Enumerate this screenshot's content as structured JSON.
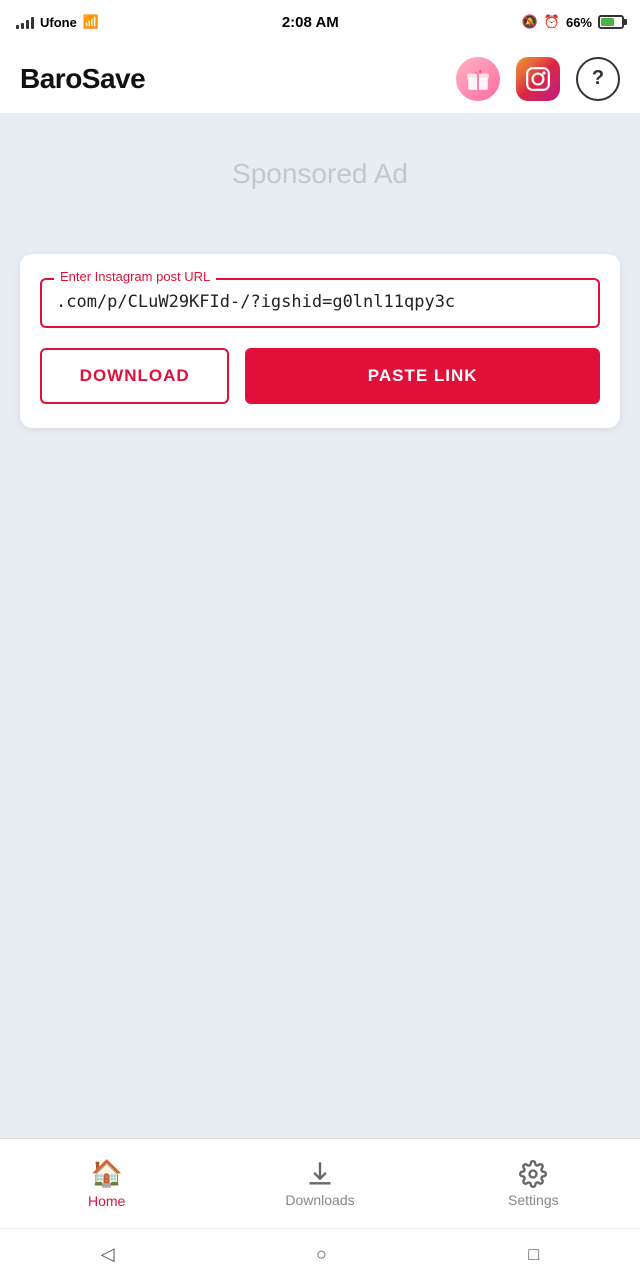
{
  "statusBar": {
    "carrier": "Ufone",
    "time": "2:08 AM",
    "battery": "66%"
  },
  "header": {
    "logo": "BaroSave"
  },
  "adArea": {
    "text": "Sponsored Ad"
  },
  "urlInput": {
    "label": "Enter Instagram post URL",
    "value": ".com/p/CLuW29KFId-/?igshid=g0lnl11qpy3c",
    "placeholder": "Enter Instagram post URL"
  },
  "buttons": {
    "download": "DOWNLOAD",
    "pasteLink": "PASTE LINK"
  },
  "bottomNav": {
    "items": [
      {
        "id": "home",
        "label": "Home",
        "icon": "🏠",
        "active": true
      },
      {
        "id": "downloads",
        "label": "Downloads",
        "icon": "⬇",
        "active": false
      },
      {
        "id": "settings",
        "label": "Settings",
        "icon": "⚙",
        "active": false
      }
    ]
  },
  "androidNav": {
    "back": "◁",
    "home": "○",
    "recents": "□"
  }
}
